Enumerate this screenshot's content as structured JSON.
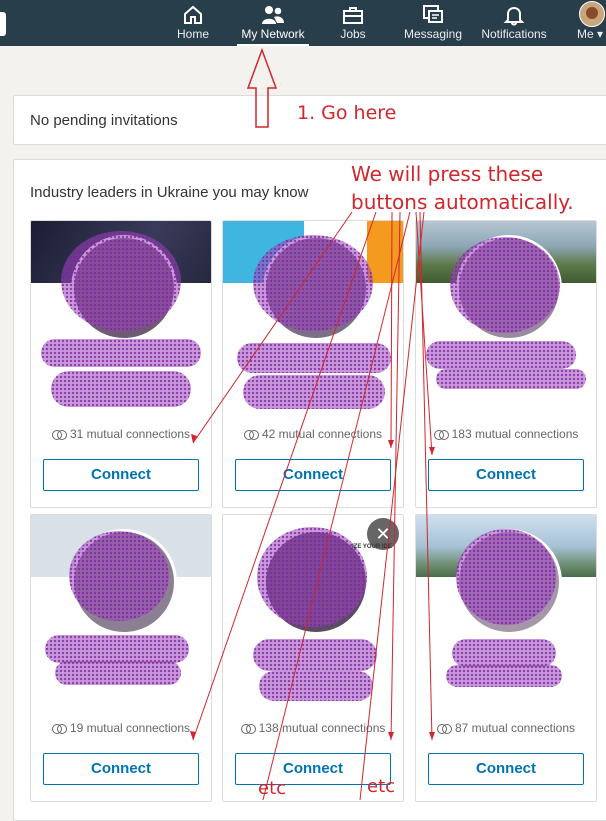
{
  "nav": {
    "items": [
      {
        "label": "Home",
        "icon": "home-icon"
      },
      {
        "label": "My Network",
        "icon": "network-icon"
      },
      {
        "label": "Jobs",
        "icon": "briefcase-icon"
      },
      {
        "label": "Messaging",
        "icon": "messaging-icon"
      },
      {
        "label": "Notifications",
        "icon": "bell-icon"
      },
      {
        "label": "Me",
        "icon": "avatar"
      }
    ],
    "active": "My Network"
  },
  "invitations": {
    "text": "No pending invitations"
  },
  "pymk": {
    "title": "Industry leaders in Ukraine you may know",
    "cards": [
      {
        "mutual": "31 mutual connections",
        "action": "Connect"
      },
      {
        "mutual": "42 mutual connections",
        "action": "Connect"
      },
      {
        "mutual": "183 mutual connections",
        "action": "Connect"
      },
      {
        "mutual": "19 mutual connections",
        "action": "Connect"
      },
      {
        "mutual": "138 mutual connections",
        "action": "Connect"
      },
      {
        "mutual": "87 mutual connections",
        "action": "Connect"
      }
    ]
  },
  "overlay": {
    "close_glyph": "✕",
    "ad_text": "IZE YOUR IDE"
  },
  "annotations": {
    "step1": "1. Go here",
    "line1": "We will press these",
    "line2": "buttons automatically.",
    "etc1": "etc",
    "etc2": "etc",
    "color": "#d0262d"
  },
  "colors": {
    "nav_bg": "#283e4a",
    "accent": "#0073b1",
    "scribble": "#a046be"
  }
}
